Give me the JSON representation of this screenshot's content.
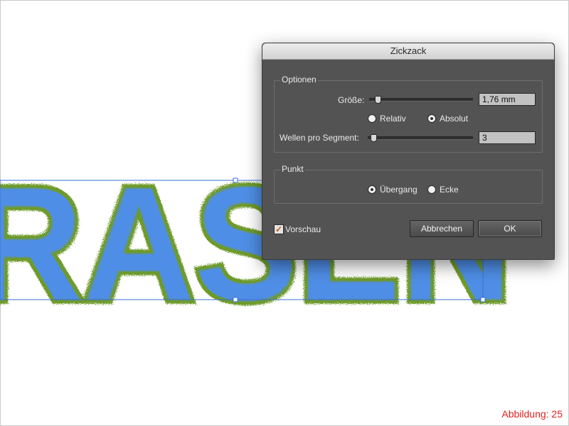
{
  "artwork": {
    "text": "RASEN",
    "fill_color": "#4f8ee6",
    "grass_color": "#6e9a2a",
    "selection_color": "#3b6fd6"
  },
  "dialog": {
    "title": "Zickzack",
    "options": {
      "legend": "Optionen",
      "size": {
        "label": "Größe:",
        "value": "1,76 mm",
        "slider_fraction": 0.06
      },
      "mode": {
        "relative_label": "Relativ",
        "absolute_label": "Absolut",
        "selected": "absolute"
      },
      "waves": {
        "label": "Wellen pro Segment:",
        "value": "3",
        "slider_fraction": 0.03
      }
    },
    "point": {
      "legend": "Punkt",
      "smooth_label": "Übergang",
      "corner_label": "Ecke",
      "selected": "smooth"
    },
    "preview": {
      "label": "Vorschau",
      "checked": true,
      "check_glyph": "✓"
    },
    "cancel_label": "Abbrechen",
    "ok_label": "OK"
  },
  "caption": "Abbildung: 25"
}
